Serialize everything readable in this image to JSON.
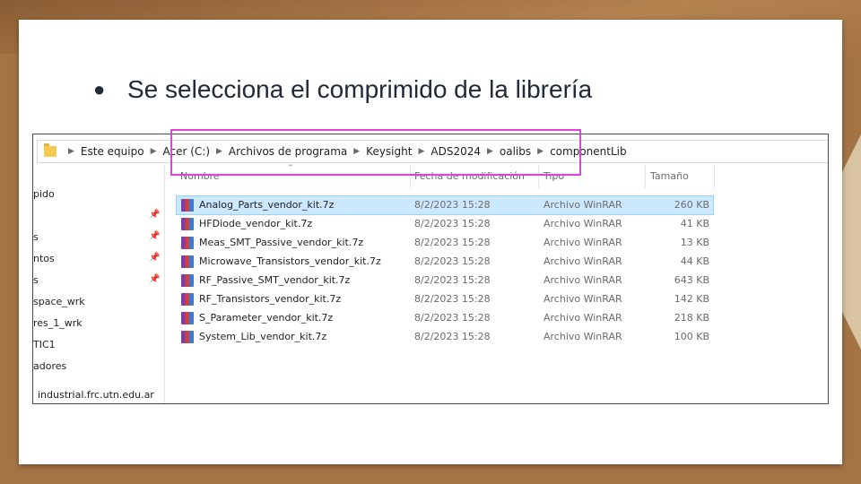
{
  "slide": {
    "bullet_symbol": "●",
    "bullet_text": "Se selecciona el comprimido de la librería"
  },
  "explorer": {
    "breadcrumb": [
      "Este equipo",
      "Acer (C:)",
      "Archivos de programa",
      "Keysight",
      "ADS2024",
      "oalibs",
      "componentLib"
    ],
    "columns": {
      "name": "Nombre",
      "date": "Fecha de modificación",
      "type": "Tipo",
      "size": "Tamaño"
    },
    "nav_items": [
      "pido",
      "s",
      "ntos",
      "s",
      "space_wrk",
      "res_1_wrk",
      "TIC1",
      "adores",
      "industrial.frc.utn.edu.ar"
    ],
    "files": [
      {
        "name": "Analog_Parts_vendor_kit.7z",
        "date": "8/2/2023 15:28",
        "type": "Archivo WinRAR",
        "size": "260 KB",
        "selected": true
      },
      {
        "name": "HFDiode_vendor_kit.7z",
        "date": "8/2/2023 15:28",
        "type": "Archivo WinRAR",
        "size": "41 KB"
      },
      {
        "name": "Meas_SMT_Passive_vendor_kit.7z",
        "date": "8/2/2023 15:28",
        "type": "Archivo WinRAR",
        "size": "13 KB"
      },
      {
        "name": "Microwave_Transistors_vendor_kit.7z",
        "date": "8/2/2023 15:28",
        "type": "Archivo WinRAR",
        "size": "44 KB"
      },
      {
        "name": "RF_Passive_SMT_vendor_kit.7z",
        "date": "8/2/2023 15:28",
        "type": "Archivo WinRAR",
        "size": "643 KB"
      },
      {
        "name": "RF_Transistors_vendor_kit.7z",
        "date": "8/2/2023 15:28",
        "type": "Archivo WinRAR",
        "size": "142 KB"
      },
      {
        "name": "S_Parameter_vendor_kit.7z",
        "date": "8/2/2023 15:28",
        "type": "Archivo WinRAR",
        "size": "218 KB"
      },
      {
        "name": "System_Lib_vendor_kit.7z",
        "date": "8/2/2023 15:28",
        "type": "Archivo WinRAR",
        "size": "100 KB"
      }
    ]
  },
  "colors": {
    "highlight": "#e040e0",
    "selection": "#cce8ff",
    "background": "#a57445"
  },
  "icons": {
    "folder": "folder-icon",
    "pin": "pin-icon",
    "archive": "winrar-archive-icon",
    "sort": "sort-up-icon"
  }
}
